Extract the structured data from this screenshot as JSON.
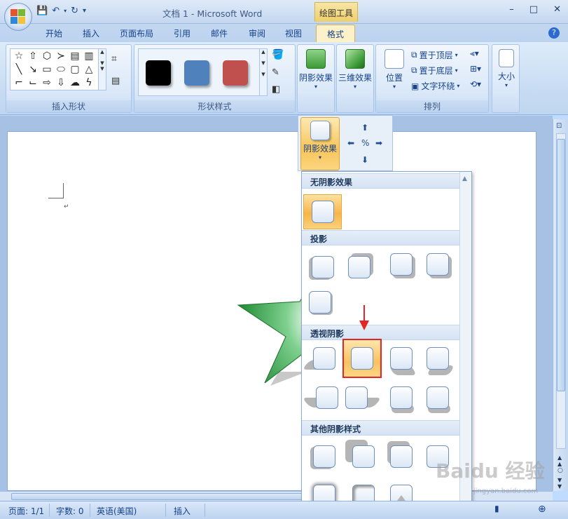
{
  "window": {
    "doc_title": "文档 1 - Microsoft Word",
    "context_tab_group": "绘图工具",
    "controls": [
      "–",
      "□",
      "✕"
    ]
  },
  "tabs": [
    "开始",
    "插入",
    "页面布局",
    "引用",
    "邮件",
    "审阅",
    "视图"
  ],
  "active_tab": "格式",
  "ribbon": {
    "groups": {
      "insert_shapes": "插入形状",
      "shape_styles": "形状样式",
      "arrange": "排列"
    },
    "shadow_effects": "阴影效果",
    "three_d_effects": "三维效果",
    "position": "位置",
    "bring_to_front": "置于顶层",
    "send_to_back": "置于底层",
    "text_wrapping": "文字环绕",
    "size": "大小",
    "style_colors": [
      "#000000",
      "#4f81bd",
      "#c0504d"
    ]
  },
  "flyout": {
    "label": "阴影效果"
  },
  "gallery": {
    "sections": [
      "无阴影效果",
      "投影",
      "透视阴影",
      "其他阴影样式"
    ]
  },
  "status": {
    "page": "页面: 1/1",
    "words": "字数: 0",
    "language": "英语(美国)",
    "mode": "插入"
  },
  "document": {
    "paragraph_mark": "↵"
  },
  "watermark": {
    "text": "Baidu 经验",
    "sub": "jingyan.baidu.com"
  }
}
